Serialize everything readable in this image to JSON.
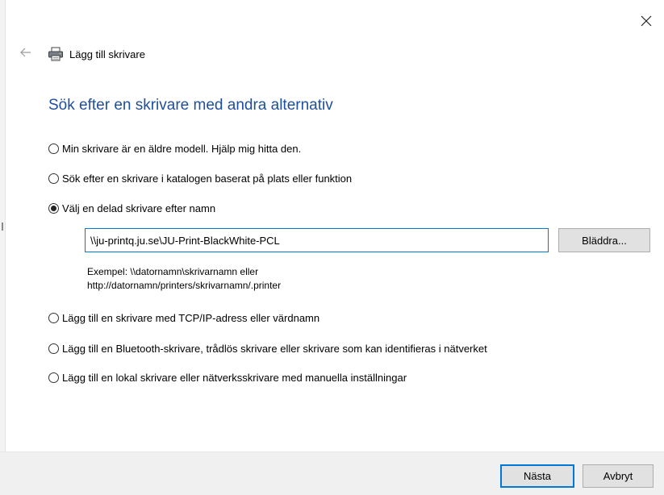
{
  "header": {
    "title": "Lägg till skrivare",
    "back_icon": "arrow-left-icon",
    "printer_icon": "printer-icon",
    "close_icon": "close-icon"
  },
  "page_title": "Sök efter en skrivare med andra alternativ",
  "options": [
    {
      "label": "Min skrivare är en äldre modell. Hjälp mig hitta den.",
      "checked": false
    },
    {
      "label": "Sök efter en skrivare i katalogen baserat på plats eller funktion",
      "checked": false
    },
    {
      "label": "Välj en delad skrivare efter namn",
      "checked": true
    },
    {
      "label": "Lägg till en skrivare med TCP/IP-adress eller värdnamn",
      "checked": false
    },
    {
      "label": "Lägg till en Bluetooth-skrivare, trådlös skrivare eller skrivare som kan identifieras i nätverket",
      "checked": false
    },
    {
      "label": "Lägg till en lokal skrivare eller nätverksskrivare med manuella inställningar",
      "checked": false
    }
  ],
  "shared_printer": {
    "value": "\\\\ju-printq.ju.se\\JU-Print-BlackWhite-PCL",
    "browse_label": "Bläddra...",
    "example_line1": "Exempel: \\\\datornamn\\skrivarnamn eller",
    "example_line2": "http://datornamn/printers/skrivarnamn/.printer"
  },
  "footer": {
    "next_label": "Nästa",
    "cancel_label": "Avbryt"
  },
  "colors": {
    "title": "#1e4f9c",
    "focus_border": "#0078d7",
    "footer_bg": "#f0f0f0"
  }
}
